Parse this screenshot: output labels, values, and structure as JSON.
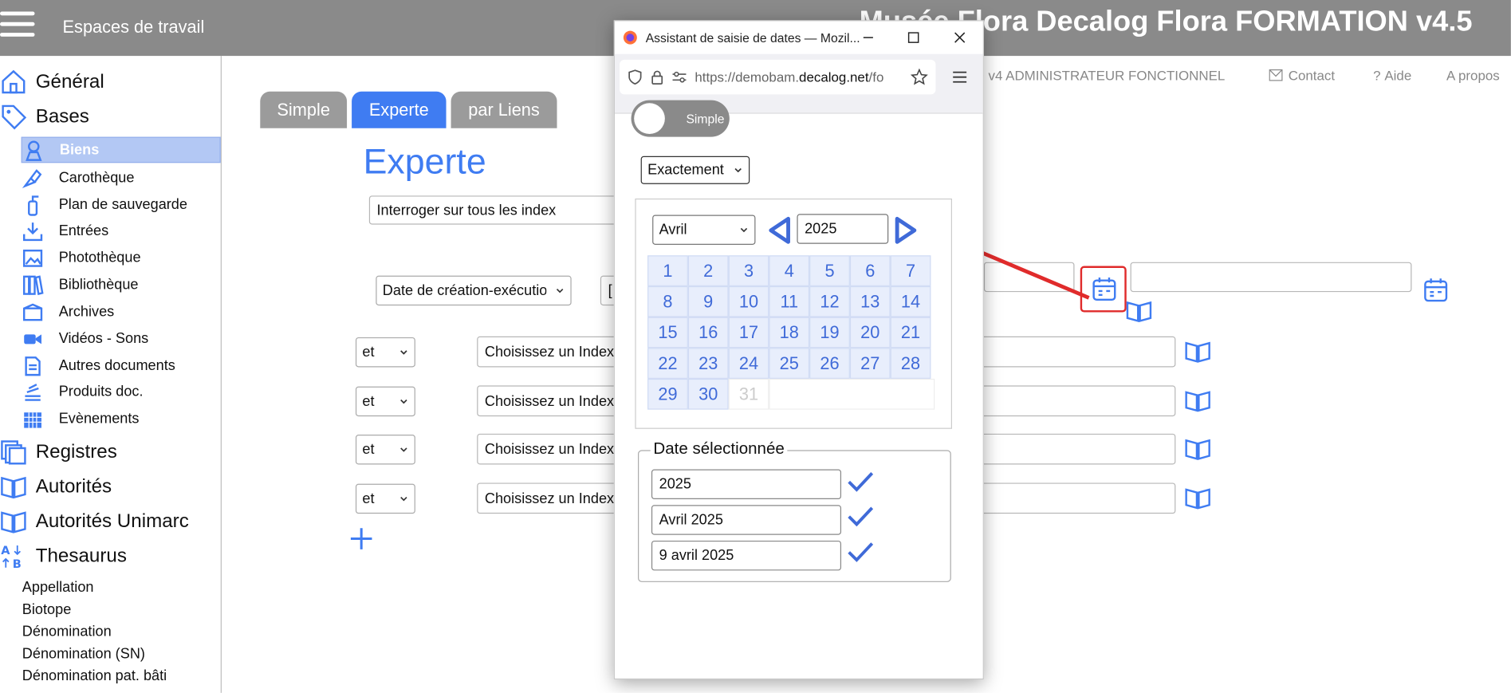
{
  "header": {
    "workspaces": "Espaces de travail",
    "app_title": "Musée Flora Decalog Flora FORMATION v4.5"
  },
  "userbar": {
    "role": "e v4 ADMINISTRATEUR FONCTIONNEL",
    "contact": "Contact",
    "aide": "Aide",
    "apropos": "A propos"
  },
  "sidebar": {
    "general": "Général",
    "bases": "Bases",
    "subitems": [
      "Biens",
      "Carothèque",
      "Plan de sauvegarde",
      "Entrées",
      "Photothèque",
      "Bibliothèque",
      "Archives",
      "Vidéos - Sons",
      "Autres documents",
      "Produits doc.",
      "Evènements"
    ],
    "registres": "Registres",
    "autorites": "Autorités",
    "autorites_unimarc": "Autorités Unimarc",
    "thesaurus": "Thesaurus",
    "thesaurus_items": [
      "Appellation",
      "Biotope",
      "Dénomination",
      "Dénomination (SN)",
      "Dénomination pat. bâti"
    ]
  },
  "tabs": [
    "Simple",
    "Experte",
    "par Liens"
  ],
  "main": {
    "heading": "Experte",
    "index_select": "Interroger sur tous les index",
    "date_field": "Date de création-exécution",
    "bracket": "[",
    "operators": [
      "et",
      "et",
      "et",
      "et"
    ],
    "choose_index": "Choisissez un Index"
  },
  "popup": {
    "window_title": "Assistant de saisie de dates — Mozil...",
    "url_prefix": "https://demobam.",
    "url_domain": "decalog.net",
    "url_suffix": "/fo",
    "toggle_label": "Simple",
    "mode_select": "Exactement",
    "month": "Avril",
    "year": "2025",
    "days": [
      "1",
      "2",
      "3",
      "4",
      "5",
      "6",
      "7",
      "8",
      "9",
      "10",
      "11",
      "12",
      "13",
      "14",
      "15",
      "16",
      "17",
      "18",
      "19",
      "20",
      "21",
      "22",
      "23",
      "24",
      "25",
      "26",
      "27",
      "28",
      "29",
      "30",
      "31"
    ],
    "selected_legend": "Date sélectionnée",
    "selected_values": [
      "2025",
      "Avril 2025",
      "9 avril 2025"
    ]
  },
  "colors": {
    "accent": "#3f7cf2",
    "header": "#8a8a8a",
    "annotation": "#e02b2b"
  }
}
